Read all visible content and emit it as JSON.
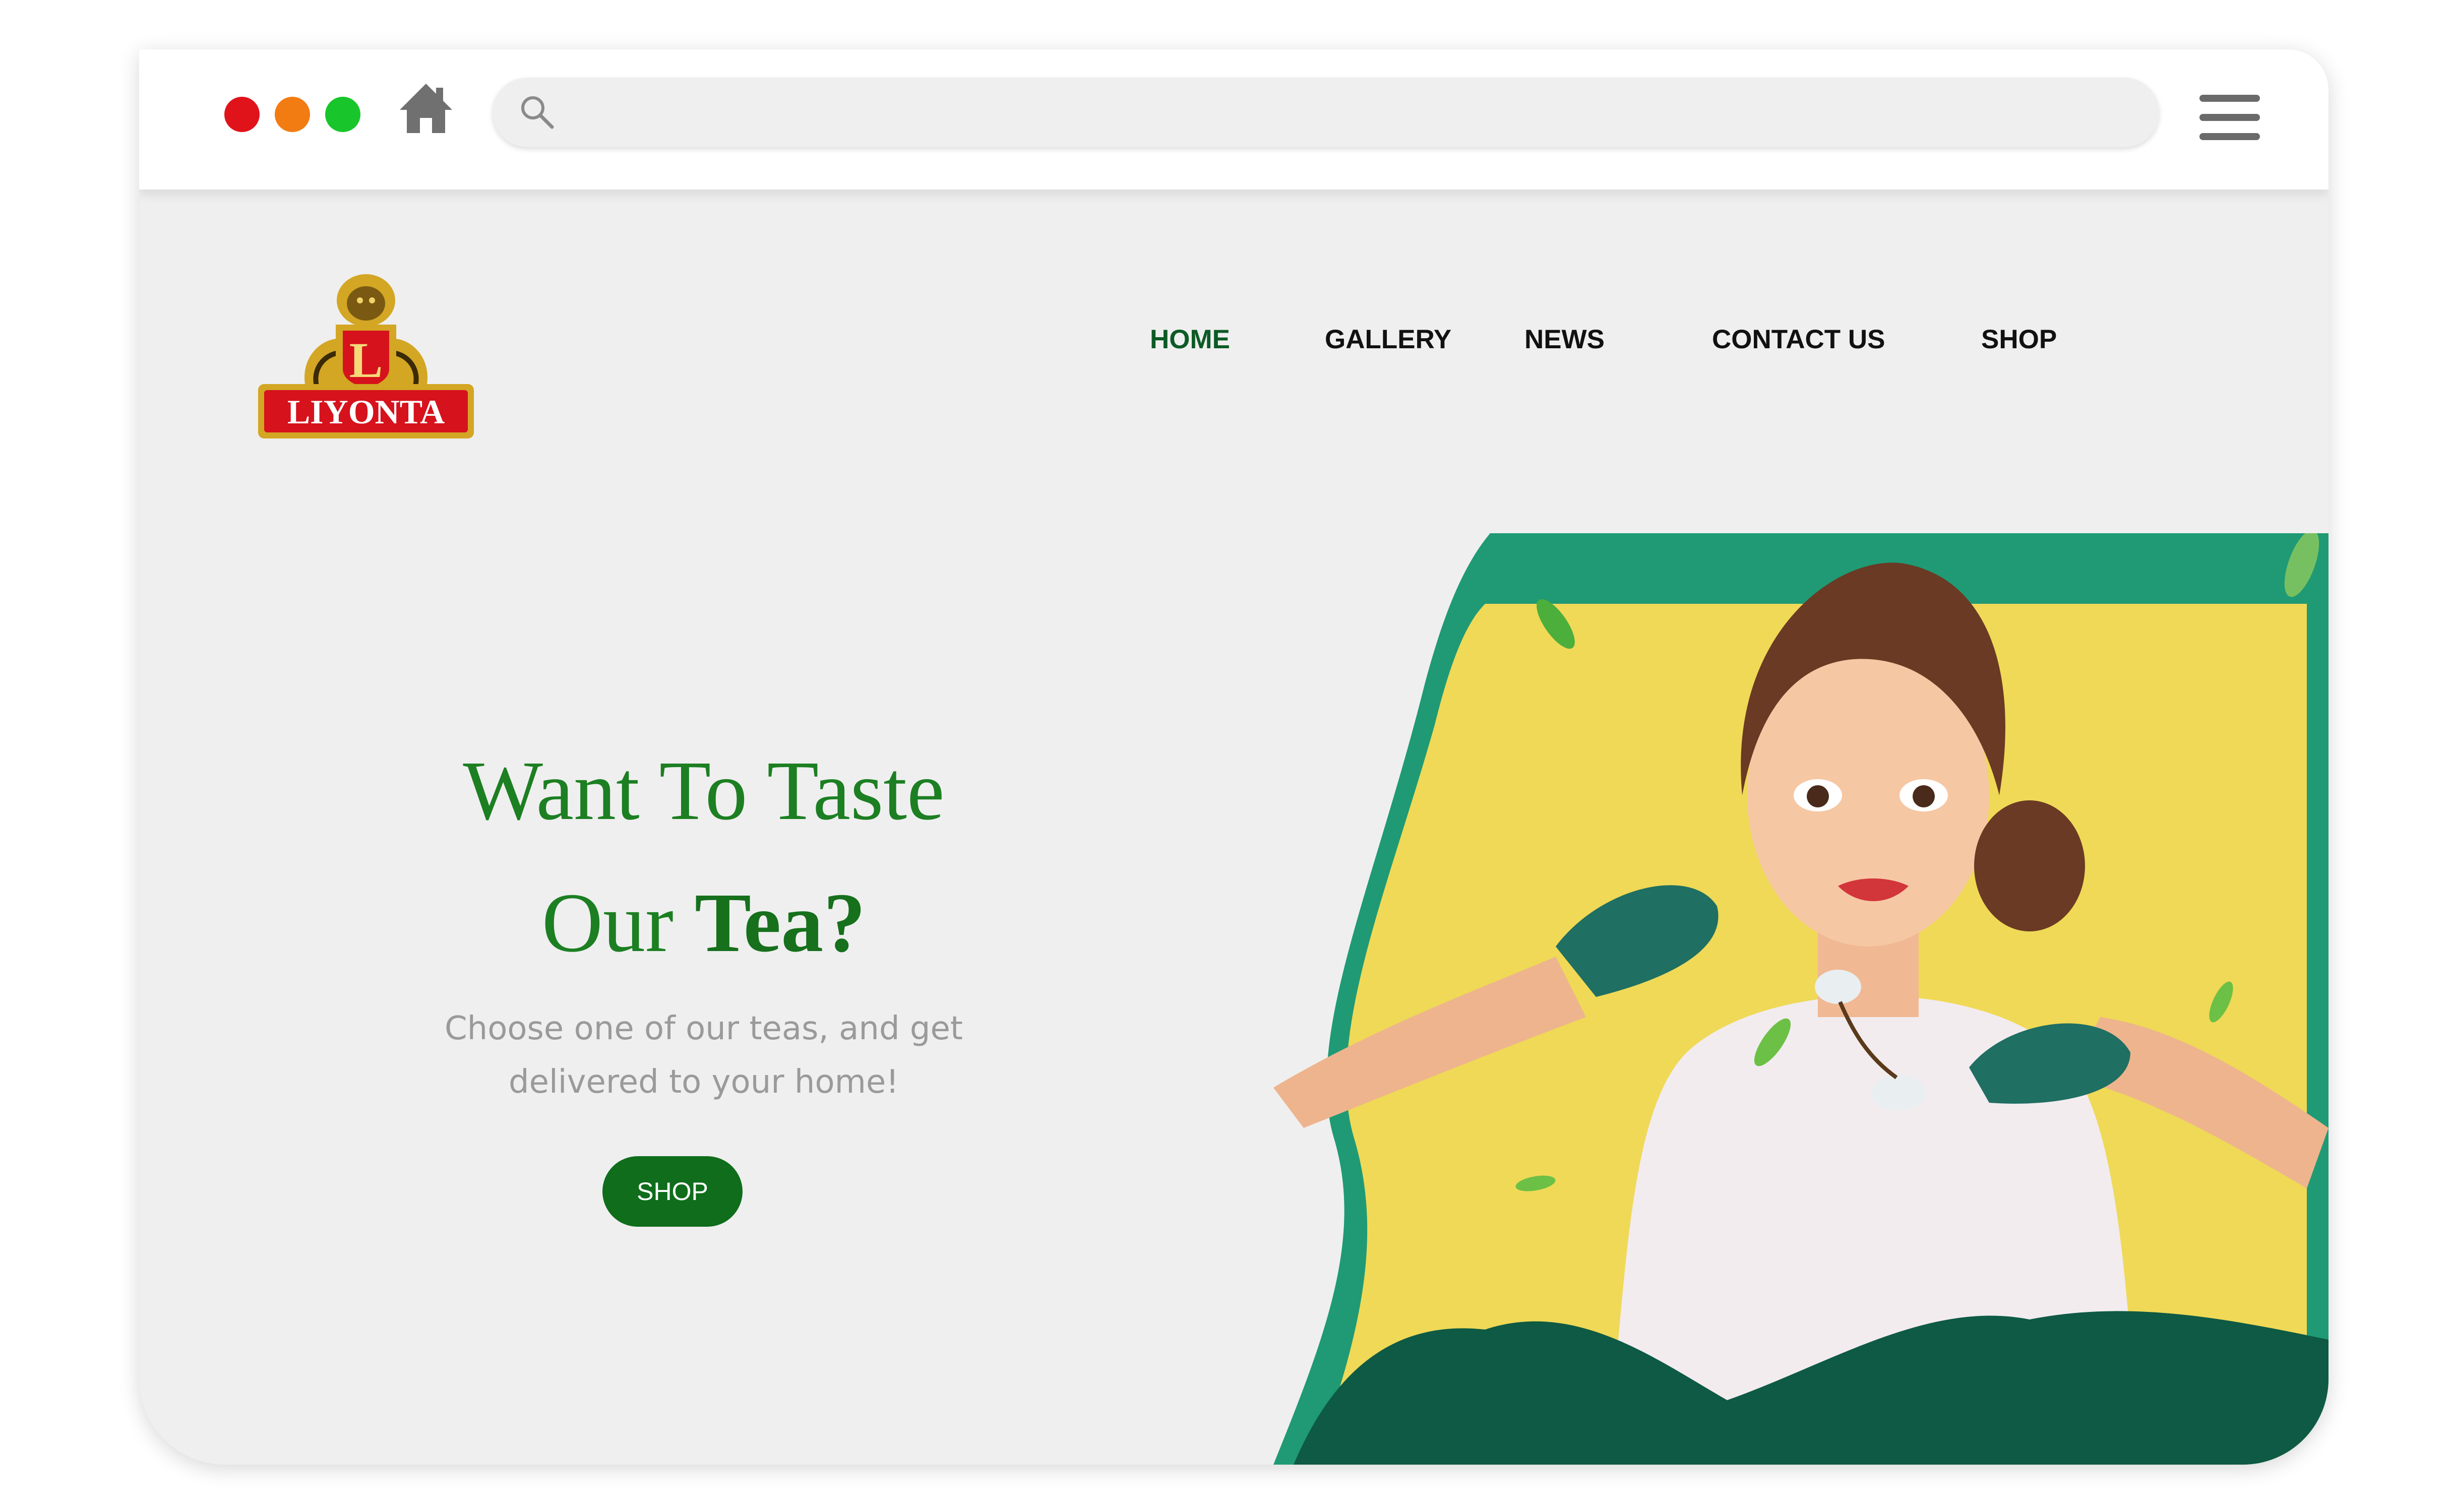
{
  "browser": {
    "window_controls": [
      "close",
      "minimize",
      "maximize"
    ],
    "home_icon": "home-icon",
    "search_icon": "search-icon",
    "address_value": "",
    "address_placeholder": "",
    "menu_icon": "hamburger-menu-icon"
  },
  "brand": {
    "logo_text": "LIYONTA",
    "logo_monogram": "L",
    "colors": {
      "red": "#d6121c",
      "gold": "#d3a624"
    }
  },
  "nav": {
    "items": [
      {
        "label": "HOME",
        "active": true
      },
      {
        "label": "GALLERY",
        "active": false
      },
      {
        "label": "NEWS",
        "active": false
      },
      {
        "label": "CONTACT US",
        "active": false
      },
      {
        "label": "SHOP",
        "active": false
      }
    ]
  },
  "hero": {
    "title_line1": "Want To Taste",
    "title_line2_regular": "Our",
    "title_line2_bold": "Tea?",
    "subtitle_line1": "Choose one of our teas, and get",
    "subtitle_line2": "delivered to your home!",
    "cta_label": "SHOP",
    "colors": {
      "title": "#1c7f22",
      "cta_bg": "#0f6d1b",
      "art_yellow": "#efd957",
      "art_teal": "#1f9a74"
    }
  }
}
